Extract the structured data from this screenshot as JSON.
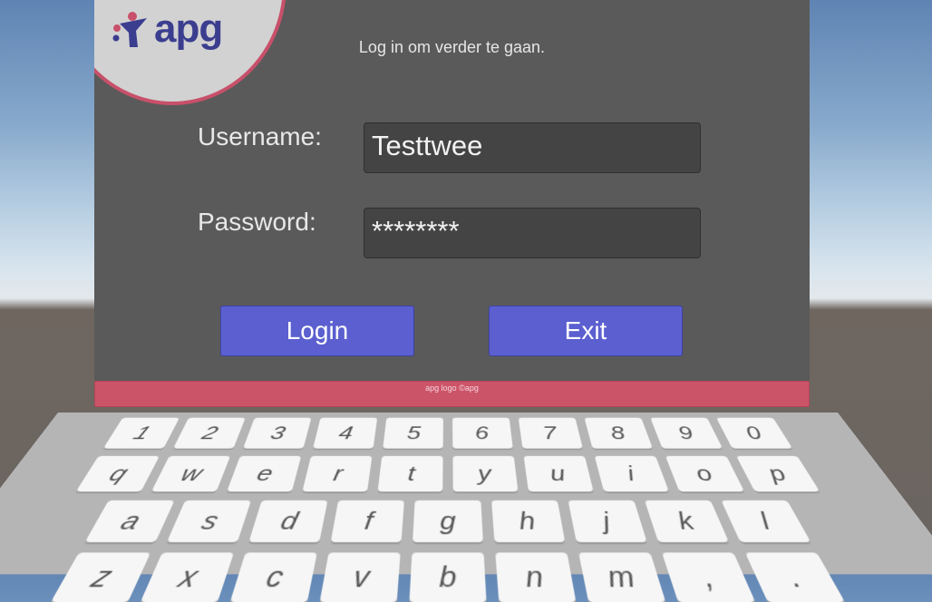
{
  "logo": {
    "text": "apg"
  },
  "subtitle": "Log in om verder te gaan.",
  "form": {
    "username_label": "Username:",
    "username_value": "Testtwee",
    "password_label": "Password:",
    "password_value": "********"
  },
  "buttons": {
    "login": "Login",
    "exit": "Exit"
  },
  "footer": "apg logo ©apg",
  "keyboard": {
    "rows": [
      [
        "1",
        "2",
        "3",
        "4",
        "5",
        "6",
        "7",
        "8",
        "9",
        "0"
      ],
      [
        "q",
        "w",
        "e",
        "r",
        "t",
        "y",
        "u",
        "i",
        "o",
        "p"
      ],
      [
        "a",
        "s",
        "d",
        "f",
        "g",
        "h",
        "j",
        "k",
        "l"
      ],
      [
        "z",
        "x",
        "c",
        "v",
        "b",
        "n",
        "m",
        ",",
        "."
      ]
    ]
  },
  "colors": {
    "panel": "#5a5a5a",
    "button": "#5b5fcf",
    "footer": "#cc5468",
    "logo_ring": "#c8506a",
    "logo_text": "#3b3d8f"
  }
}
